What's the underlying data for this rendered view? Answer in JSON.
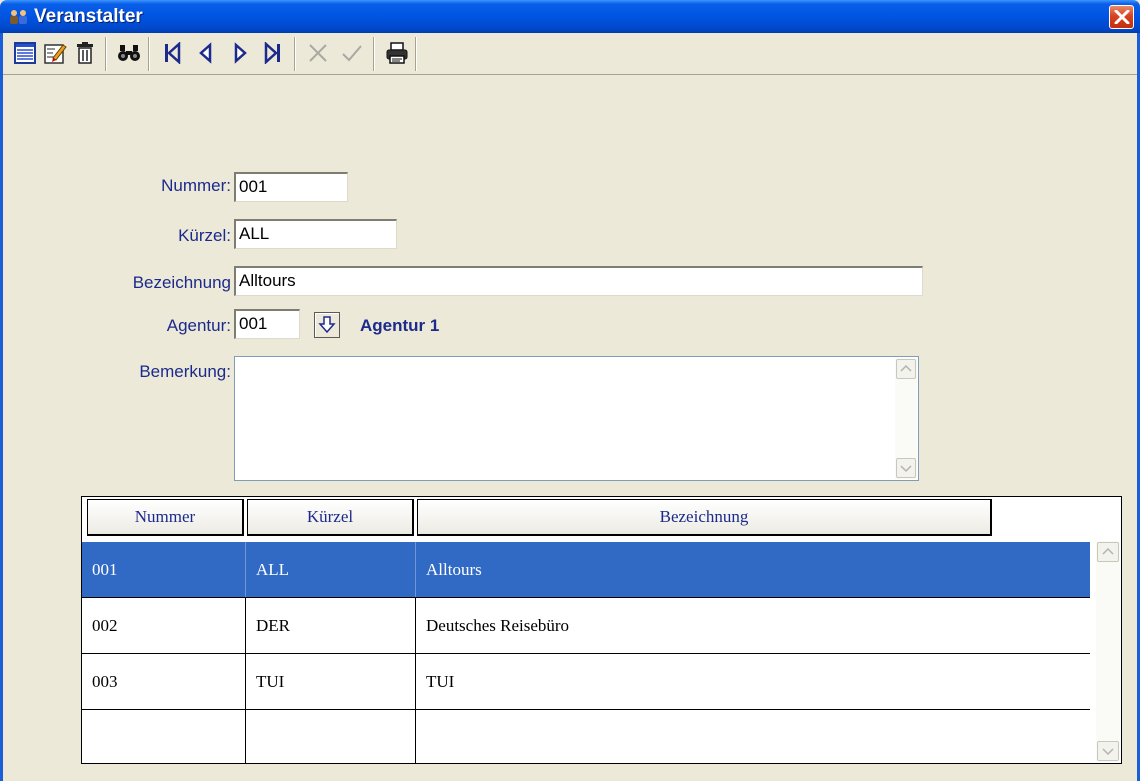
{
  "window": {
    "title": "Veranstalter",
    "title_icon": "people-icon",
    "close_icon": "close-icon"
  },
  "toolbar": {
    "buttons": [
      {
        "name": "new-record-button",
        "icon": "list-icon",
        "enabled": true
      },
      {
        "name": "edit-record-button",
        "icon": "edit-icon",
        "enabled": true
      },
      {
        "name": "delete-record-button",
        "icon": "trash-icon",
        "enabled": true
      },
      {
        "name": "search-button",
        "icon": "binoculars-icon",
        "enabled": true
      },
      {
        "name": "first-record-button",
        "icon": "first-icon",
        "enabled": true
      },
      {
        "name": "prev-record-button",
        "icon": "prev-icon",
        "enabled": true
      },
      {
        "name": "next-record-button",
        "icon": "next-icon",
        "enabled": true
      },
      {
        "name": "last-record-button",
        "icon": "last-icon",
        "enabled": true
      },
      {
        "name": "cancel-button",
        "icon": "cross-icon",
        "enabled": false
      },
      {
        "name": "confirm-button",
        "icon": "check-icon",
        "enabled": false
      },
      {
        "name": "print-button",
        "icon": "printer-icon",
        "enabled": true
      }
    ]
  },
  "form": {
    "nummer_label": "Nummer:",
    "nummer_value": "001",
    "kuerzel_label": "Kürzel:",
    "kuerzel_value": "ALL",
    "bezeichnung_label": "Bezeichnung",
    "bezeichnung_value": "Alltours",
    "agentur_label": "Agentur:",
    "agentur_value": "001",
    "agentur_name": "Agentur 1",
    "bemerkung_label": "Bemerkung:",
    "bemerkung_value": ""
  },
  "grid": {
    "columns": [
      "Nummer",
      "Kürzel",
      "Bezeichnung"
    ],
    "rows": [
      {
        "nummer": "001",
        "kuerzel": "ALL",
        "bezeichnung": "Alltours",
        "selected": true
      },
      {
        "nummer": "002",
        "kuerzel": "DER",
        "bezeichnung": "Deutsches Reisebüro",
        "selected": false
      },
      {
        "nummer": "003",
        "kuerzel": "TUI",
        "bezeichnung": "TUI",
        "selected": false
      },
      {
        "nummer": "",
        "kuerzel": "",
        "bezeichnung": "",
        "selected": false
      }
    ]
  },
  "colors": {
    "title_bar": "#0054e3",
    "selection": "#316ac5",
    "label_text": "#1c2a8c",
    "window_bg": "#ece9d8"
  }
}
